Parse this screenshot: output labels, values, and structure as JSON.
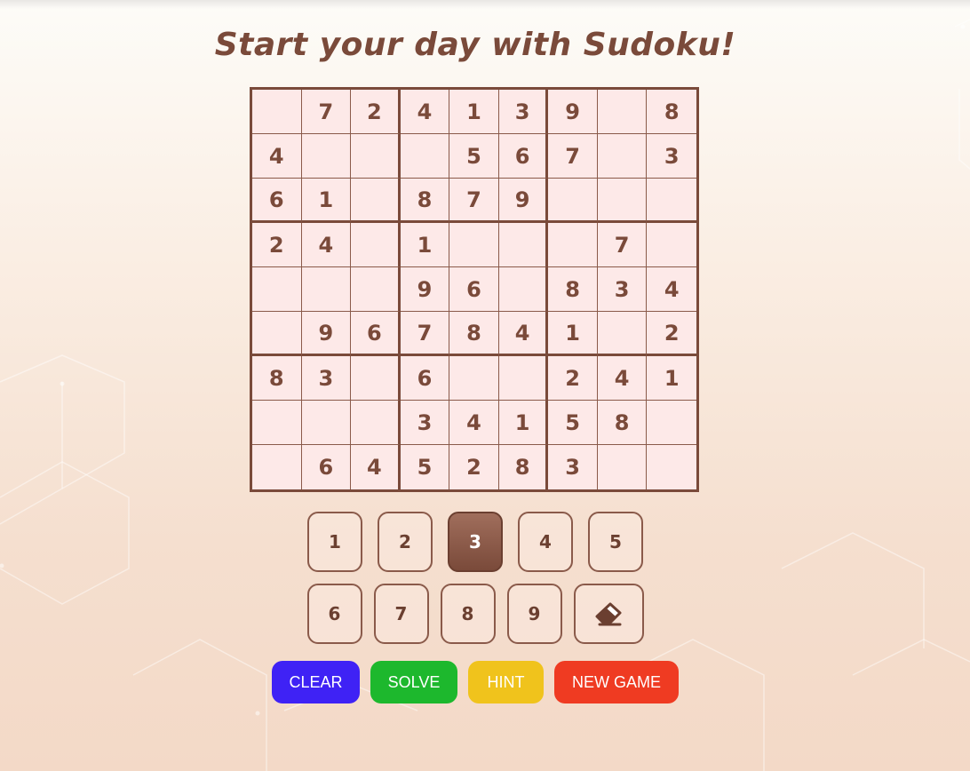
{
  "title": "Start your day with Sudoku!",
  "grid": [
    [
      "",
      "7",
      "2",
      "4",
      "1",
      "3",
      "9",
      "",
      "8"
    ],
    [
      "4",
      "",
      "",
      "",
      "5",
      "6",
      "7",
      "",
      "3"
    ],
    [
      "6",
      "1",
      "",
      "8",
      "7",
      "9",
      "",
      "",
      ""
    ],
    [
      "2",
      "4",
      "",
      "1",
      "",
      "",
      "",
      "7",
      ""
    ],
    [
      "",
      "",
      "",
      "9",
      "6",
      "",
      "8",
      "3",
      "4"
    ],
    [
      "",
      "9",
      "6",
      "7",
      "8",
      "4",
      "1",
      "",
      "2"
    ],
    [
      "8",
      "3",
      "",
      "6",
      "",
      "",
      "2",
      "4",
      "1"
    ],
    [
      "",
      "",
      "",
      "3",
      "4",
      "1",
      "5",
      "8",
      ""
    ],
    [
      "",
      "6",
      "4",
      "5",
      "2",
      "8",
      "3",
      "",
      ""
    ]
  ],
  "numpad": {
    "row1": [
      "1",
      "2",
      "3",
      "4",
      "5"
    ],
    "row2": [
      "6",
      "7",
      "8",
      "9"
    ],
    "selected": "3",
    "erase_icon": "eraser-icon"
  },
  "actions": {
    "clear": "CLEAR",
    "solve": "SOLVE",
    "hint": "HINT",
    "new_game": "NEW GAME"
  },
  "colors": {
    "text": "#7a4a3a",
    "cell_bg": "#fde9e8",
    "clear": "#3f22f5",
    "solve": "#1db82d",
    "hint": "#f0c31c",
    "new_game": "#ef3b22"
  }
}
